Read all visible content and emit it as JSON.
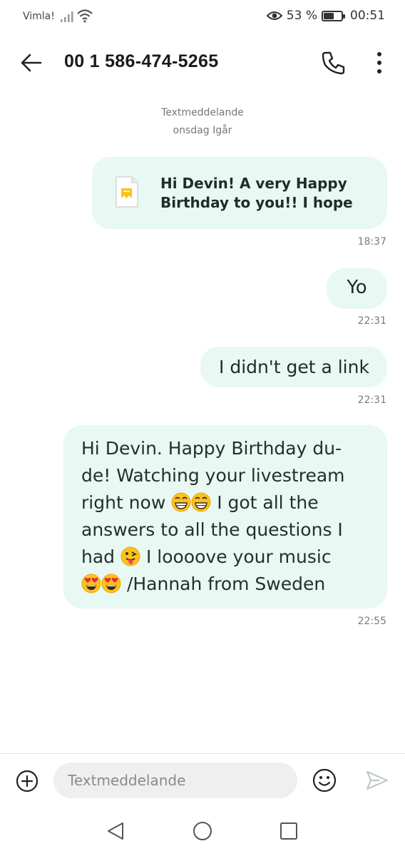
{
  "status_bar": {
    "carrier": "Vimla!",
    "battery_percent": "53 %",
    "battery_level": 0.53,
    "time": "00:51"
  },
  "header": {
    "contact": "00 1 586-474-5265",
    "icons": [
      "back-arrow-icon",
      "phone-icon",
      "more-vertical-icon"
    ]
  },
  "thread": {
    "channel_label": "Textmeddelande",
    "date_label": "onsdag Igår",
    "messages": [
      {
        "text": "Hi Devin! A very Happy Birthday to you!! I hope",
        "time": "18:37",
        "attachment_icon": "document-icon"
      },
      {
        "text": "Yo",
        "time": "22:31"
      },
      {
        "text": "I didn't get a link",
        "time": "22:31"
      },
      {
        "lines": [
          "Hi Devin. Happy Birthday du-",
          "de! Watching your livestream",
          "right now",
          "I got all the",
          "answers to all the questions I",
          "had",
          "I loooove your music",
          "/Hannah from Sweden"
        ],
        "emojis": [
          "grinning-face",
          "grinning-face",
          "winking-tongue-face",
          "heart-eyes-face",
          "heart-eyes-face"
        ],
        "time": "22:55"
      }
    ]
  },
  "composer": {
    "placeholder": "Textmeddelande",
    "icons": [
      "add-circle-icon",
      "smiley-icon",
      "send-icon"
    ]
  },
  "nav_bar": {
    "icons": [
      "nav-back-icon",
      "nav-home-icon",
      "nav-recents-icon"
    ]
  },
  "colors": {
    "bubble": "#e8f8f3",
    "accent_doc": "#f5c518"
  }
}
